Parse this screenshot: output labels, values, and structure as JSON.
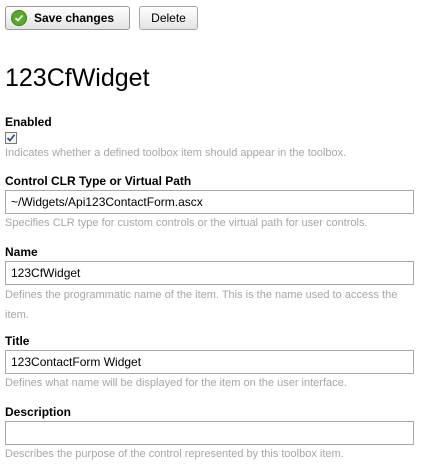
{
  "toolbar": {
    "save_label": "Save changes",
    "delete_label": "Delete"
  },
  "page_title": "123CfWidget",
  "fields": {
    "enabled": {
      "label": "Enabled",
      "checked": true,
      "hint": "Indicates whether a defined toolbox item should appear in the toolbox."
    },
    "control_type": {
      "label": "Control CLR Type or Virtual Path",
      "value": "~/Widgets/Api123ContactForm.ascx",
      "hint": "Specifies CLR type for custom controls or the virtual path for user controls."
    },
    "name": {
      "label": "Name",
      "value": "123CfWidget",
      "hint": "Defines the programmatic name of the item. This is the name used to access the item."
    },
    "title": {
      "label": "Title",
      "value": "123ContactForm Widget",
      "hint": "Defines what name will be displayed for the item on the user interface."
    },
    "description": {
      "label": "Description",
      "value": "",
      "hint": "Describes the purpose of the control represented by this toolbox item."
    }
  },
  "icons": {
    "save": "check-circle-icon",
    "checkbox": "checkmark-icon"
  },
  "colors": {
    "save_icon": "#5aa82a",
    "hint_text": "#a6a6a6",
    "input_border": "#a9a9a9"
  }
}
